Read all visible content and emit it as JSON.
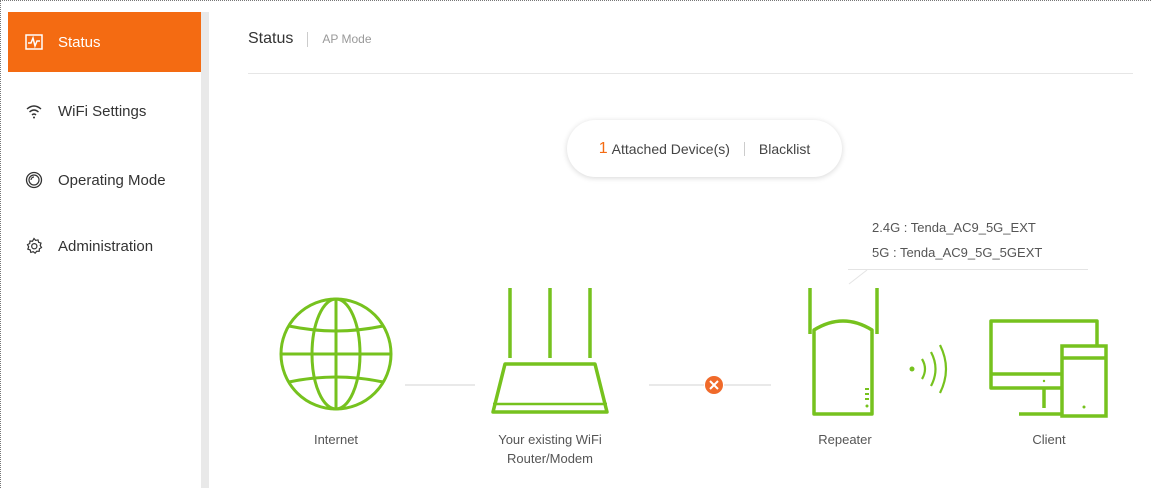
{
  "sidebar": {
    "items": [
      {
        "label": "Status",
        "icon": "pulse-icon",
        "active": true
      },
      {
        "label": "WiFi Settings",
        "icon": "wifi-icon",
        "active": false
      },
      {
        "label": "Operating Mode",
        "icon": "mode-icon",
        "active": false
      },
      {
        "label": "Administration",
        "icon": "gear-icon",
        "active": false
      }
    ]
  },
  "header": {
    "title": "Status",
    "mode": "AP Mode"
  },
  "devices_pill": {
    "count": "1",
    "attached_label": "Attached Device(s)",
    "blacklist_label": "Blacklist"
  },
  "ssid": {
    "line_24g": "2.4G :  Tenda_AC9_5G_EXT",
    "line_5g": "5G :  Tenda_AC9_5G_5GEXT"
  },
  "diagram": {
    "internet_label": "Internet",
    "router_label_1": "Your existing WiFi",
    "router_label_2": "Router/Modem",
    "repeater_label": "Repeater",
    "client_label": "Client"
  },
  "colors": {
    "accent": "#f46b12",
    "device_green": "#76c21e",
    "error_orange": "#f06a2a"
  }
}
